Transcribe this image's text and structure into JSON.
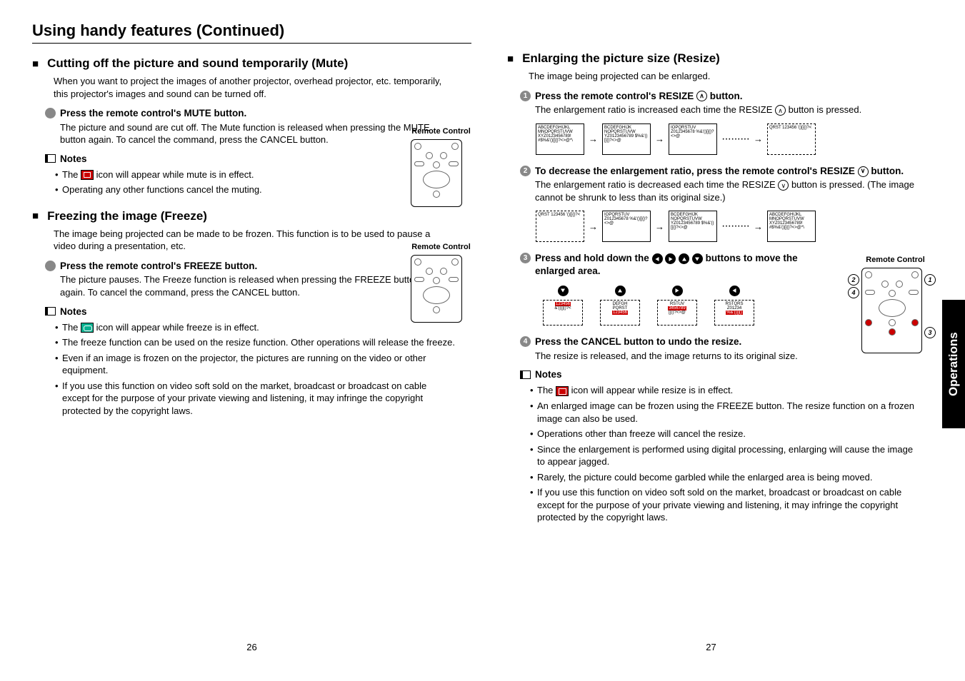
{
  "main_title": "Using handy features (Continued)",
  "side_tab": "Operations",
  "page_left": "26",
  "page_right": "27",
  "left": {
    "section1": {
      "title": "Cutting off the picture and sound temporarily (Mute)",
      "intro": "When you want to project the images of another projector, overhead projector, etc. temporarily, this projector's images and sound can be turned off.",
      "step1_title": "Press the remote control's MUTE button.",
      "step1_text": "The picture and sound are cut off. The Mute function is released when pressing the MUTE button again. To cancel the command, press the CANCEL button.",
      "notes_h": "Notes",
      "note1a": "The ",
      "note1b": " icon will appear while mute is in effect.",
      "note2": "Operating any other functions cancel the muting."
    },
    "section2": {
      "title": "Freezing the image (Freeze)",
      "intro": "The image being projected can be made to be frozen. This function is to be used to pause a video during a presentation, etc.",
      "step1_title": "Press the remote control's FREEZE button.",
      "step1_text": "The picture pauses. The Freeze function is released when pressing the FREEZE button again. To cancel the command, press the CANCEL button.",
      "notes_h": "Notes",
      "note1a": "The ",
      "note1b": " icon will appear while freeze is in effect.",
      "note2": "The freeze function can be used on the resize function. Other operations will release the freeze.",
      "note3": "Even if an image is frozen on the projector, the pictures are running on the video or other equipment.",
      "note4": "If you use this function on video soft sold on the market, broadcast or broadcast on cable except for the purpose of your private viewing and listening, it may infringe the copyright protected by the copyright laws."
    },
    "remote_label": "Remote Control"
  },
  "right": {
    "section1": {
      "title": "Enlarging the picture size (Resize)",
      "intro": "The image being projected can be enlarged.",
      "step1_title_a": "Press the remote control's RESIZE ",
      "step1_title_b": " button.",
      "step1_text_a": "The enlargement ratio is increased each time the RESIZE ",
      "step1_text_b": " button is pressed.",
      "step2_title_a": "To decrease the enlargement ratio, press the remote control's RESIZE ",
      "step2_title_b": " button.",
      "step2_text_a": "The enlargement ratio is decreased each time the RESIZE ",
      "step2_text_b": " button is pressed. (The image cannot be shrunk to less than its original size.)",
      "step3_title_a": "Press and hold down the ",
      "step3_title_b": " buttons to move the enlarged area.",
      "step4_title": "Press the CANCEL button to undo the resize.",
      "step4_text": "The resize is released, and the image returns to its original size.",
      "notes_h": "Notes",
      "note1a": "The ",
      "note1b": " icon will appear while resize is in effect.",
      "note2": "An enlarged image can be frozen using the FREEZE button. The resize function on a frozen image can also be used.",
      "note3": "Operations other than freeze will cancel the resize.",
      "note4": "Since the enlargement is performed using digital processing, enlarging will cause the image to appear jagged.",
      "note5": "Rarely, the picture could become garbled while the enlarged area is being moved.",
      "note6": "If you use this function on video soft sold on the market, broadcast or broadcast on cable except for the purpose of your private viewing and listening, it may infringe the copyright protected by the copyright laws."
    },
    "remote_label": "Remote Control",
    "dg_text1": "ABCDEFGHIJKL MNOPQRSTUVW XYZ0123456789! #$%&'()[]{}?<>@*\\",
    "dg_text2": "BCDEFGHIJK NOPQRSTUVW YZ0123456789 $%&'()[]{}?<>@",
    "dg_text3": "IOPQRSTUV Z012345678 %&'()[]{}?<>@",
    "dg_text4": "QRST 123456 '()[]{}?<",
    "navrow": {
      "b1a": "123456",
      "b1b": "&'()[]()?<",
      "b2a": "DEFGH",
      "b2b": "PQRST",
      "b2c": "123456",
      "b3a": "RSTUV",
      "b3b": "3456789",
      "b3c": "[]()?<>@",
      "b4a": "RSTQRS",
      "b4b": "Z01234",
      "b4c": "%&'()[]()"
    }
  }
}
